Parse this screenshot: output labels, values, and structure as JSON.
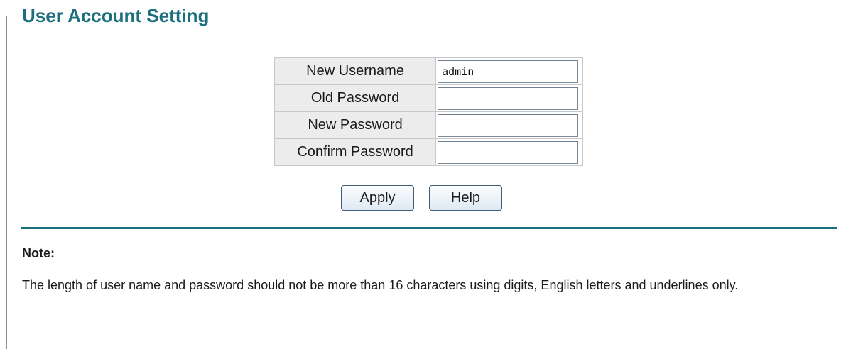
{
  "section": {
    "title": "User Account Setting"
  },
  "form": {
    "fields": [
      {
        "label": "New Username",
        "value": "admin",
        "type": "text"
      },
      {
        "label": "Old Password",
        "value": "",
        "type": "password"
      },
      {
        "label": "New Password",
        "value": "",
        "type": "password"
      },
      {
        "label": "Confirm Password",
        "value": "",
        "type": "password"
      }
    ]
  },
  "actions": {
    "apply_label": "Apply",
    "help_label": "Help"
  },
  "note": {
    "title": "Note:",
    "text": "The length of user name and password should not be more than 16 characters using digits, English letters and underlines only."
  },
  "colors": {
    "accent": "#1c6f7d",
    "label_bg": "#ececec"
  }
}
